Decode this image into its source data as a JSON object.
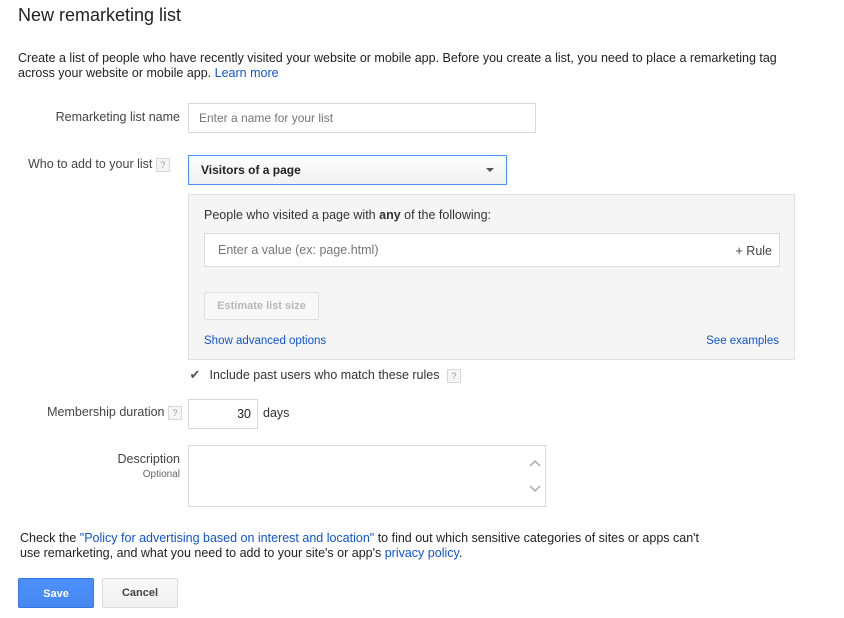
{
  "page": {
    "title": "New remarketing list"
  },
  "intro": {
    "text": "Create a list of people who have recently visited your website or mobile app. Before you create a list, you need to place a remarketing tag across your website or mobile app.",
    "learn_more": "Learn more"
  },
  "list_name": {
    "label": "Remarketing list name",
    "placeholder": "Enter a name for your list"
  },
  "who_to_add": {
    "label": "Who to add to your list",
    "help": "?",
    "selected": "Visitors of a page"
  },
  "rules": {
    "heading_pre": "People who visited a page with ",
    "heading_bold": "any",
    "heading_post": " of the following:",
    "value_placeholder": "Enter a value (ex: page.html)",
    "add_rule": "+ Rule",
    "estimate": "Estimate list size",
    "advanced": "Show advanced options",
    "examples": "See examples"
  },
  "past_users": {
    "label": "Include past users who match these rules",
    "checked": true,
    "help": "?"
  },
  "membership": {
    "label": "Membership duration",
    "help": "?",
    "value": "30",
    "unit": "days"
  },
  "description": {
    "label": "Description",
    "optional": "Optional"
  },
  "policy": {
    "pre": "Check the ",
    "policy_link": "\"Policy for advertising based on interest and location\"",
    "mid": " to find out which sensitive categories of sites or apps can't use remarketing, and what you need to add to your site's or app's ",
    "privacy_link": "privacy policy",
    "post": "."
  },
  "actions": {
    "save": "Save",
    "cancel": "Cancel"
  },
  "colors": {
    "link": "#1155cc",
    "primary": "#4d90fe",
    "select_border": "#4d90fe"
  }
}
